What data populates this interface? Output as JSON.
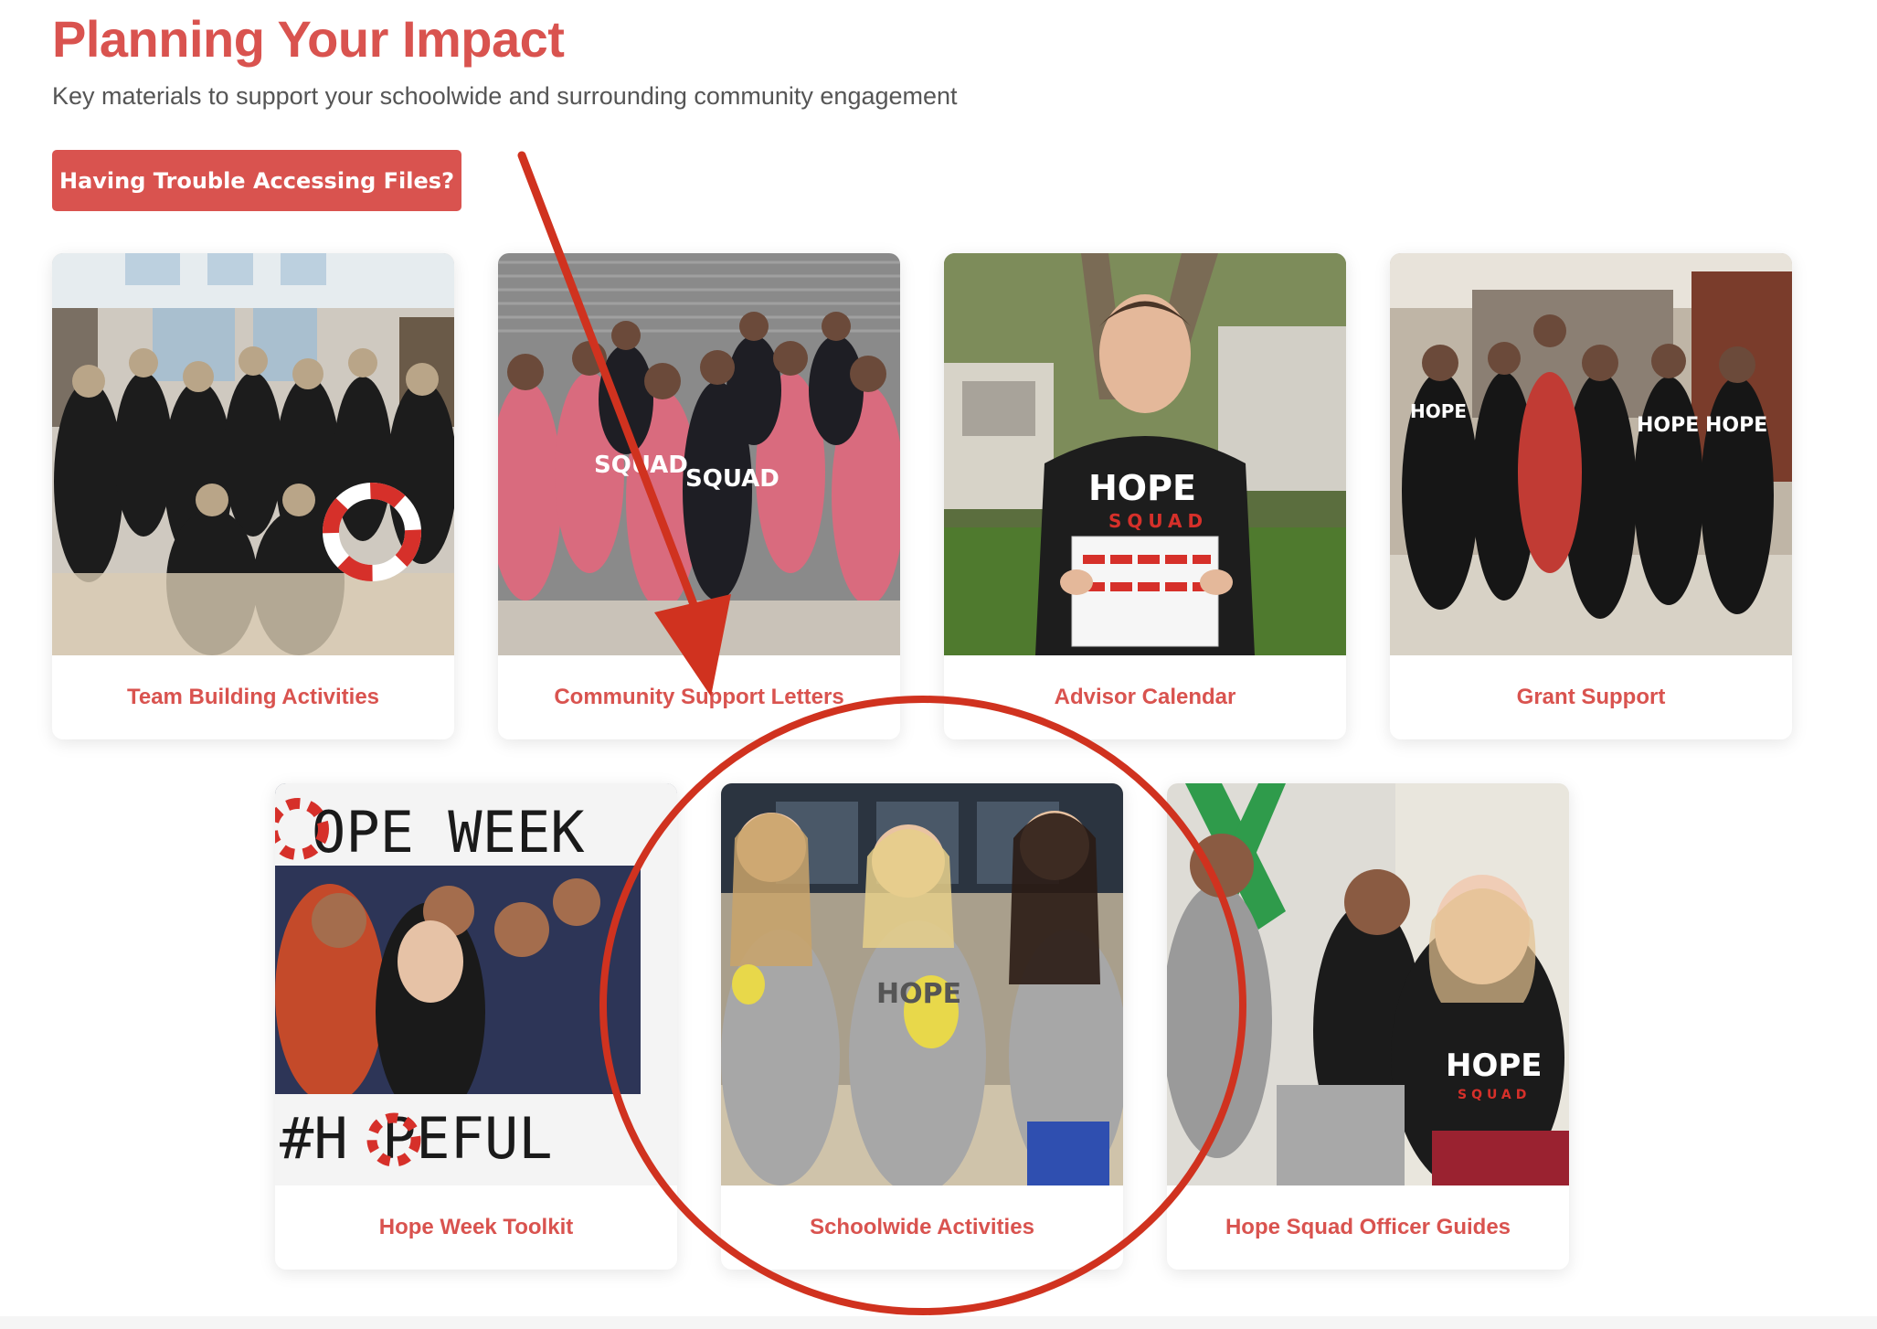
{
  "header": {
    "title": "Planning Your Impact",
    "subtitle": "Key materials to support your schoolwide and surrounding community engagement",
    "trouble_button": "Having Trouble Accessing Files?"
  },
  "colors": {
    "accent": "#d9534f",
    "annotation": "#d0321f",
    "subtitle": "#555555"
  },
  "cards": [
    {
      "label": "Team Building Activities"
    },
    {
      "label": "Community Support Letters"
    },
    {
      "label": "Advisor Calendar"
    },
    {
      "label": "Grant Support"
    },
    {
      "label": "Hope Week Toolkit"
    },
    {
      "label": "Schoolwide Activities"
    },
    {
      "label": "Hope Squad Officer Guides"
    }
  ],
  "photo_text": {
    "hope": "HOPE",
    "squad": "SQUAD",
    "hope_week": "OPE WEEK",
    "hopeful": "#H PEFUL"
  },
  "annotations": {
    "arrow": "red-arrow-icon",
    "circle": "red-circle-highlight"
  }
}
